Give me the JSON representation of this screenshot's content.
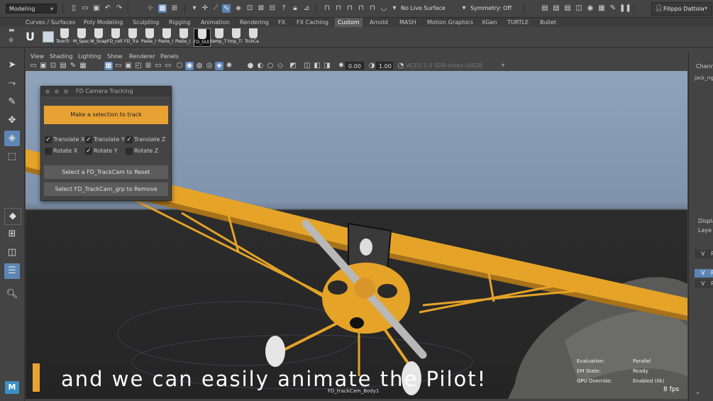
{
  "statusline": {
    "mode": "Modeling",
    "live_surface": "No Live Surface",
    "symmetry": "Symmetry: Off",
    "user": "Filippo Dattola"
  },
  "shelf_tabs": [
    "Curves / Surfaces",
    "Poly Modeling",
    "Sculpting",
    "Rigging",
    "Animation",
    "Rendering",
    "FX",
    "FX Caching",
    "Custom",
    "Arnold",
    "MASH",
    "Motion Graphics",
    "XGen",
    "TURTLE",
    "Bullet"
  ],
  "shelf_tab_active": "Custom",
  "shelf_buttons": [
    "ToonTr",
    "M_Spac",
    "W_Snap",
    "FD_coll",
    "FD_Tra",
    "Paste_I",
    "Paste_I",
    "Paste_I",
    "FD_GUI",
    "temp_T",
    "tmp_Ti",
    "TrckCa"
  ],
  "panel_menu": [
    "View",
    "Shading",
    "Lighting",
    "Show",
    "Renderer",
    "Panels"
  ],
  "panel_tools": {
    "exposure": "0.00",
    "gamma": "1.00",
    "colorspace": "ACES 1.0 SDR-video (sRGB"
  },
  "tracking_window": {
    "title": "FD Camera Tracking",
    "track_button": "Make a selection to track",
    "checks": [
      {
        "label": "Translate X",
        "checked": true
      },
      {
        "label": "Translate Y",
        "checked": true
      },
      {
        "label": "Translate Z",
        "checked": true
      },
      {
        "label": "Rotate X",
        "checked": false
      },
      {
        "label": "Rotate Y",
        "checked": true
      },
      {
        "label": "Rotate Z",
        "checked": false
      }
    ],
    "reset_button": "Select a FD_TrackCam to Reset",
    "remove_button": "Select FD_TrackCam_grp to Remove"
  },
  "subtitle": "and we can easily animate the Pilot!",
  "hud": {
    "evaluation_label": "Evaluation:",
    "evaluation_value": "Parallel",
    "em_state_label": "EM State:",
    "em_state_value": "Ready",
    "gpu_label": "GPU Override:",
    "gpu_value": "Enabled (0k)",
    "camera": "FD_trackCam_Body1",
    "fps": "8 fps"
  },
  "right_panel": {
    "channels": "Chann",
    "object": "jack_rig",
    "display": "Displa",
    "layers": "Laye",
    "rows": [
      "V",
      "V",
      "V"
    ],
    "row_letters": [
      "P",
      "P",
      "P"
    ]
  },
  "maya_logo": "M",
  "colors": {
    "accent_orange": "#e8a133",
    "selection_blue": "#5d86b5",
    "plane_yellow": "#e5a328"
  }
}
